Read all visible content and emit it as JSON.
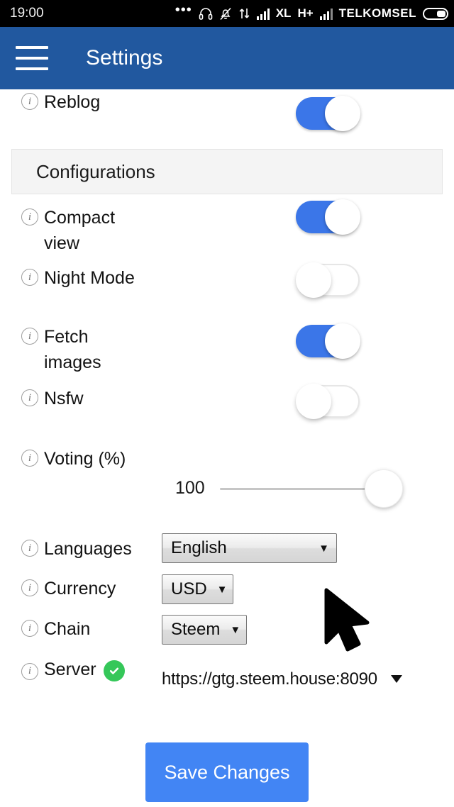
{
  "status_bar": {
    "time": "19:00",
    "overflow_dots": "•••",
    "network_type": "H+",
    "operator_short": "XL",
    "carrier": "TELKOMSEL",
    "icons": [
      "more-dots-icon",
      "headphones-icon",
      "bell-muted-icon",
      "data-transfer-icon",
      "signal-bars-icon",
      "signal-bars-secondary-icon",
      "battery-icon"
    ]
  },
  "app_bar": {
    "title": "Settings",
    "menu_icon": "hamburger-menu-icon"
  },
  "top_setting": {
    "label": "Reblog",
    "info_icon": "info-icon",
    "toggle": "on"
  },
  "section": {
    "title": "Configurations"
  },
  "toggles": [
    {
      "label": "Compact view",
      "toggle": "on"
    },
    {
      "label": "Night Mode",
      "toggle": "off"
    },
    {
      "label": "Fetch images",
      "toggle": "on"
    },
    {
      "label": "Nsfw",
      "toggle": "off"
    }
  ],
  "voting": {
    "label": "Voting (%)",
    "value": "100",
    "min": "0",
    "max": "100"
  },
  "selects": [
    {
      "label": "Languages",
      "value": "English",
      "caret": "▼"
    },
    {
      "label": "Currency",
      "value": "USD",
      "caret": "▼"
    },
    {
      "label": "Chain",
      "value": "Steem",
      "caret": "▼"
    }
  ],
  "server": {
    "label": "Server",
    "status_icon": "check-circle-icon",
    "status": "connected",
    "url": "https://gtg.steem.house:8090",
    "caret": "▼"
  },
  "footer": {
    "save_label": "Save Changes"
  },
  "colors": {
    "app_bar": "#21589f",
    "accent": "#4285f4",
    "toggle_on": "#3b76e8",
    "status_ok": "#35c759",
    "section_bg": "#f4f4f4"
  },
  "cursor": {
    "icon": "mouse-pointer-icon"
  }
}
